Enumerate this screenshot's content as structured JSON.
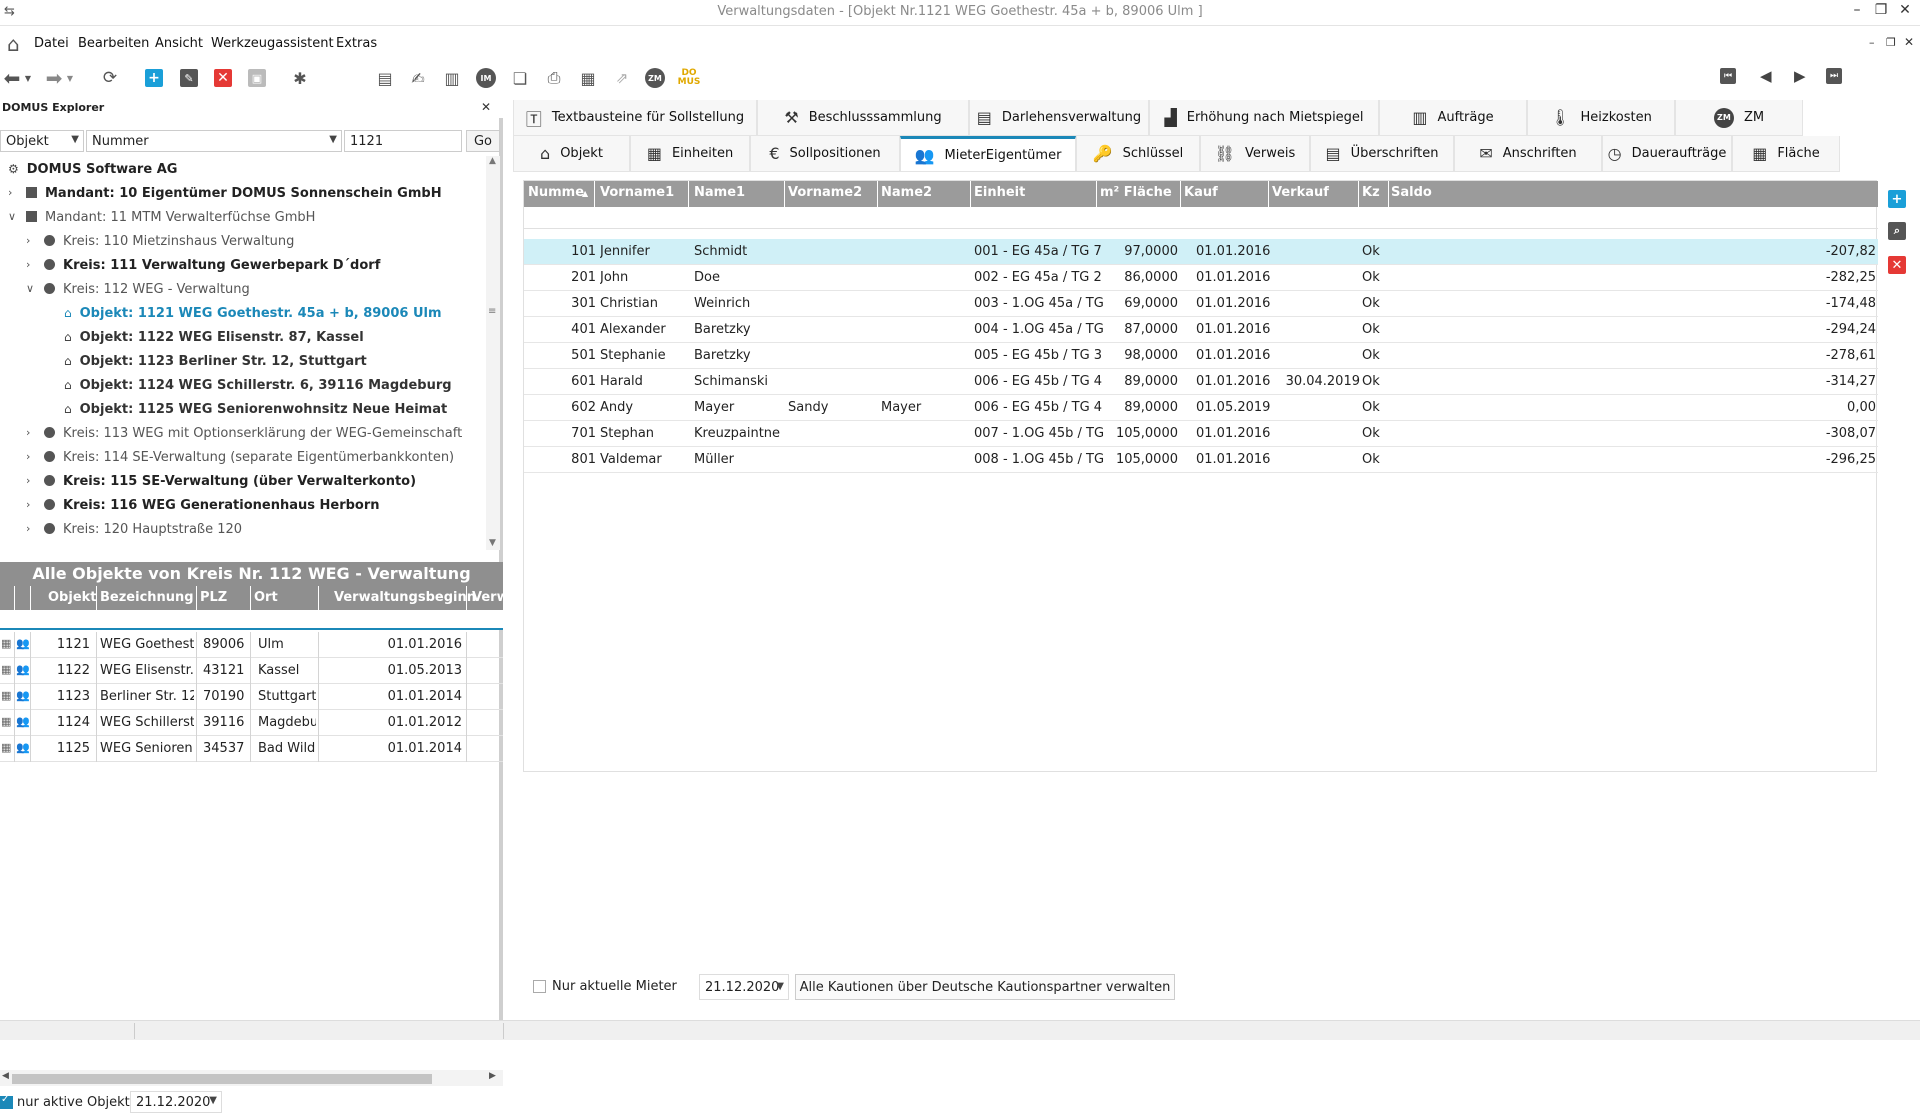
{
  "window": {
    "title": "Verwaltungsdaten - [Objekt   Nr.1121   WEG Goethestr. 45a + b, 89006 Ulm ]"
  },
  "menu": [
    "Datei",
    "Bearbeiten",
    "Ansicht",
    "Werkzeugassistent",
    "Extras"
  ],
  "toolbar": {
    "im_label": "IM",
    "zm_label": "ZM",
    "domus_label": "DO MUS"
  },
  "explorer": {
    "title": "DOMUS Explorer",
    "search_type": "Objekt",
    "search_field": "Nummer",
    "search_value": "1121",
    "go_label": "Go",
    "tree": [
      {
        "text": "DOMUS Software AG",
        "style": "root"
      },
      {
        "text": "Mandant: 10 Eigentümer DOMUS Sonnenschein GmbH",
        "style": "mandant-bold"
      },
      {
        "text": "Mandant: 11 MTM Verwalterfüchse GmbH",
        "style": "mandant"
      },
      {
        "text": "Kreis: 110 Mietzinshaus Verwaltung",
        "style": "kreis"
      },
      {
        "text": "Kreis: 111 Verwaltung Gewerbepark D´dorf",
        "style": "kreis-bold"
      },
      {
        "text": "Kreis: 112 WEG - Verwaltung",
        "style": "kreis-open"
      },
      {
        "text": "Objekt: 1121 WEG Goethestr. 45a + b, 89006 Ulm",
        "style": "objekt-active"
      },
      {
        "text": "Objekt: 1122 WEG Elisenstr. 87, Kassel",
        "style": "objekt"
      },
      {
        "text": "Objekt: 1123 Berliner Str. 12, Stuttgart",
        "style": "objekt"
      },
      {
        "text": "Objekt: 1124 WEG Schillerstr. 6, 39116 Magdeburg",
        "style": "objekt"
      },
      {
        "text": "Objekt: 1125 WEG Seniorenwohnsitz Neue Heimat",
        "style": "objekt"
      },
      {
        "text": "Kreis: 113 WEG mit Optionserklärung der WEG-Gemeinschaft",
        "style": "kreis"
      },
      {
        "text": "Kreis: 114 SE-Verwaltung (separate Eigentümerbankkonten)",
        "style": "kreis"
      },
      {
        "text": "Kreis: 115 SE-Verwaltung (über Verwalterkonto)",
        "style": "kreis-bold"
      },
      {
        "text": "Kreis: 116 WEG Generationenhaus Herborn",
        "style": "kreis-bold"
      },
      {
        "text": "Kreis: 120 Hauptstraße 120",
        "style": "kreis"
      }
    ]
  },
  "objects_list": {
    "title": "Alle Objekte von Kreis Nr. 112 WEG - Verwaltung",
    "columns": [
      "Objekt",
      "Bezeichnung",
      "PLZ",
      "Ort",
      "Verwaltungsbeginn",
      "Verw"
    ],
    "rows": [
      [
        "1121",
        "WEG Goethest",
        "89006",
        "Ulm",
        "01.01.2016"
      ],
      [
        "1122",
        "WEG Elisenstr.",
        "43121",
        "Kassel",
        "01.05.2013"
      ],
      [
        "1123",
        "Berliner Str. 12",
        "70190",
        "Stuttgart",
        "01.01.2014"
      ],
      [
        "1124",
        "WEG Schillerst",
        "39116",
        "Magdebu",
        "01.01.2012"
      ],
      [
        "1125",
        "WEG Senioren",
        "34537",
        "Bad Wild",
        "01.01.2014"
      ]
    ],
    "only_active_label": "nur aktive Objekte",
    "only_active_date": "21.12.2020"
  },
  "tabs_row1": [
    {
      "label": "Textbausteine für Sollstellung",
      "icon": "text-icon"
    },
    {
      "label": "Beschlusssammlung",
      "icon": "hammer-icon"
    },
    {
      "label": "Darlehensverwaltung",
      "icon": "list-icon"
    },
    {
      "label": "Erhöhung nach Mietspiegel",
      "icon": "chart-icon"
    },
    {
      "label": "Aufträge",
      "icon": "orders-icon"
    },
    {
      "label": "Heizkosten",
      "icon": "thermometer-icon"
    },
    {
      "label": "ZM",
      "icon": "zm-icon"
    }
  ],
  "tabs_row2": [
    {
      "label": "Objekt",
      "icon": "home-icon"
    },
    {
      "label": "Einheiten",
      "icon": "building-icon"
    },
    {
      "label": "Sollpositionen",
      "icon": "euro-icon"
    },
    {
      "label": "MieterEigentümer",
      "icon": "users-icon"
    },
    {
      "label": "Schlüssel",
      "icon": "key-icon"
    },
    {
      "label": "Verweis",
      "icon": "link-icon"
    },
    {
      "label": "Überschriften",
      "icon": "heading-icon"
    },
    {
      "label": "Anschriften",
      "icon": "envelope-icon"
    },
    {
      "label": "Daueraufträge",
      "icon": "clock-icon"
    },
    {
      "label": "Fläche",
      "icon": "area-icon"
    }
  ],
  "grid": {
    "columns": [
      "Numme",
      "Vorname1",
      "Name1",
      "Vorname2",
      "Name2",
      "Einheit",
      "m² Fläche",
      "Kauf",
      "Verkauf",
      "Kz",
      "Saldo"
    ],
    "sort_indicator": "▲",
    "rows": [
      [
        "101",
        "Jennifer",
        "Schmidt",
        "",
        "",
        "001 - EG  45a / TG 7",
        "97,0000",
        "01.01.2016",
        "",
        "Ok",
        "-207,82"
      ],
      [
        "201",
        "John",
        "Doe",
        "",
        "",
        "002 - EG  45a / TG 2",
        "86,0000",
        "01.01.2016",
        "",
        "Ok",
        "-282,25"
      ],
      [
        "301",
        "Christian",
        "Weinrich",
        "",
        "",
        "003 - 1.OG  45a / TG",
        "69,0000",
        "01.01.2016",
        "",
        "Ok",
        "-174,48"
      ],
      [
        "401",
        "Alexander",
        "Baretzky",
        "",
        "",
        "004 - 1.OG  45a / TG",
        "87,0000",
        "01.01.2016",
        "",
        "Ok",
        "-294,24"
      ],
      [
        "501",
        "Stephanie",
        "Baretzky",
        "",
        "",
        "005 - EG  45b / TG 3",
        "98,0000",
        "01.01.2016",
        "",
        "Ok",
        "-278,61"
      ],
      [
        "601",
        "Harald",
        "Schimanski",
        "",
        "",
        "006 - EG  45b / TG 4",
        "89,0000",
        "01.01.2016",
        "30.04.2019",
        "Ok",
        "-314,27"
      ],
      [
        "602",
        "Andy",
        "Mayer",
        "Sandy",
        "Mayer",
        "006 - EG  45b / TG 4",
        "89,0000",
        "01.05.2019",
        "",
        "Ok",
        "0,00"
      ],
      [
        "701",
        "Stephan",
        "Kreuzpaintne",
        "",
        "",
        "007 - 1.OG  45b / TG",
        "105,0000",
        "01.01.2016",
        "",
        "Ok",
        "-308,07"
      ],
      [
        "801",
        "Valdemar",
        "Müller",
        "",
        "",
        "008 - 1.OG  45b / TG",
        "105,0000",
        "01.01.2016",
        "",
        "Ok",
        "-296,25"
      ]
    ]
  },
  "footer": {
    "only_current_label": "Nur aktuelle Mieter",
    "date": "21.12.2020",
    "kaution_button": "Alle Kautionen  über Deutsche  Kautionspartner verwalten"
  },
  "colors": {
    "accent": "#1b88b8",
    "header_grey": "#9b9b9b",
    "selected_row": "#d0f0f7",
    "add": "#1a9fd8",
    "delete": "#e53935"
  }
}
